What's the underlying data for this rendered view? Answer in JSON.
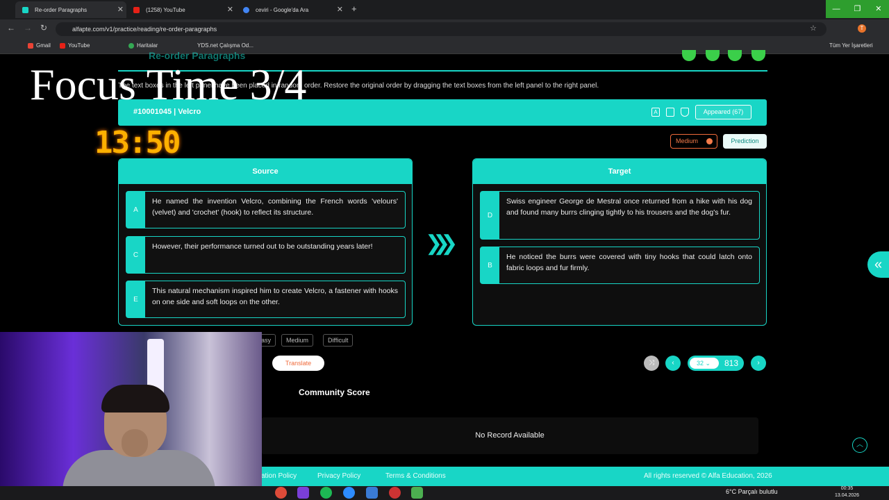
{
  "browser": {
    "tabs": [
      {
        "title": "Re-order Paragraphs",
        "active": true
      },
      {
        "title": "(1258) YouTube",
        "active": false
      },
      {
        "title": "ceviri - Google'da Ara",
        "active": false
      }
    ],
    "new_tab": "+",
    "url": "alfapte.com/v1/practice/reading/re-order-paragraphs",
    "bookmarks": [
      "Gmail",
      "YouTube",
      "Haritalar",
      "YDS.net Çalışma Od...",
      "Tüm Yer İşaretleri"
    ]
  },
  "overlay": {
    "focus_title": "Focus Time 3/4",
    "timer": "13:50"
  },
  "page": {
    "header_title": "Re-order Paragraphs",
    "instructions": "The text boxes in the left panel have been placed in random order. Restore the original order by dragging the text boxes from the left panel to the right panel.",
    "question_title": "#10001045 | Velcro",
    "appeared": "Appeared (67)",
    "difficulty_badge": "Medium",
    "prediction_badge": "Prediction",
    "source": {
      "title": "Source",
      "cards": [
        {
          "label": "A",
          "text": "He named the invention Velcro, combining the French words 'velours' (velvet) and 'crochet' (hook) to reflect its structure."
        },
        {
          "label": "C",
          "text": "However, their performance turned out to be outstanding years later!"
        },
        {
          "label": "E",
          "text": "This natural mechanism inspired him to create Velcro, a fastener with hooks on one side and soft loops on the other."
        }
      ]
    },
    "target": {
      "title": "Target",
      "cards": [
        {
          "label": "D",
          "text": "Swiss engineer George de Mestral once returned from a hike with his dog and found many burrs clinging tightly to his trousers and the dog's fur."
        },
        {
          "label": "B",
          "text": "He noticed the burrs were covered with tiny hooks that could latch onto fabric loops and fur firmly."
        }
      ]
    },
    "levels": [
      "asy",
      "Medium",
      "Difficult"
    ],
    "translate": "Translate",
    "pagination": {
      "current": "32",
      "total": "813"
    },
    "community_score": "Community Score",
    "no_record": "No Record Available",
    "footer": {
      "links": [
        "ation Policy",
        "Privacy Policy",
        "Terms & Conditions"
      ],
      "copyright": "All rights reserved © Alfa Education, 2026"
    }
  },
  "taskbar": {
    "weather": "6°C  Parçalı bulutlu",
    "time": "00:35",
    "date": "13.04.2026"
  },
  "colors": {
    "accent": "#18d6c6",
    "orange": "#f06a3a",
    "timer": "#ffb000"
  }
}
